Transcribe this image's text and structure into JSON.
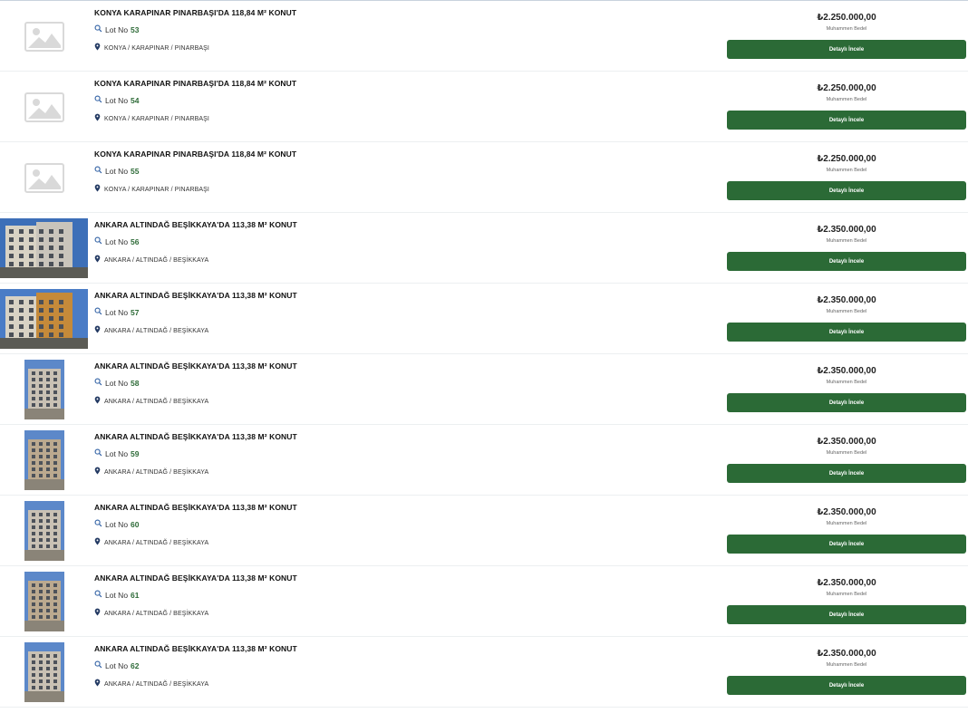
{
  "colors": {
    "accent": "#2b6a36",
    "lot_number": "#2e6b38",
    "divider": "#eceff1"
  },
  "listings": [
    {
      "title": "KONYA KARAPINAR PINARBAŞI'DA 118,84 M² KONUT",
      "lot_label": "Lot No",
      "lot_no": "53",
      "location": "KONYA / KARAPINAR / PINARBAŞI",
      "price": "₺2.250.000,00",
      "price_caption": "Muhammen Bedel",
      "button": "Detaylı İncele",
      "image": "placeholder"
    },
    {
      "title": "KONYA KARAPINAR PINARBAŞI'DA 118,84 M² KONUT",
      "lot_label": "Lot No",
      "lot_no": "54",
      "location": "KONYA / KARAPINAR / PINARBAŞI",
      "price": "₺2.250.000,00",
      "price_caption": "Muhammen Bedel",
      "button": "Detaylı İncele",
      "image": "placeholder"
    },
    {
      "title": "KONYA KARAPINAR PINARBAŞI'DA 118,84 M² KONUT",
      "lot_label": "Lot No",
      "lot_no": "55",
      "location": "KONYA / KARAPINAR / PINARBAŞI",
      "price": "₺2.250.000,00",
      "price_caption": "Muhammen Bedel",
      "button": "Detaylı İncele",
      "image": "placeholder"
    },
    {
      "title": "ANKARA ALTINDAĞ BEŞİKKAYA'DA 113,38 M² KONUT",
      "lot_label": "Lot No",
      "lot_no": "56",
      "location": "ANKARA / ALTINDAĞ / BEŞİKKAYA",
      "price": "₺2.350.000,00",
      "price_caption": "Muhammen Bedel",
      "button": "Detaylı İncele",
      "image": "photo-wide"
    },
    {
      "title": "ANKARA ALTINDAĞ BEŞİKKAYA'DA 113,38 M² KONUT",
      "lot_label": "Lot No",
      "lot_no": "57",
      "location": "ANKARA / ALTINDAĞ / BEŞİKKAYA",
      "price": "₺2.350.000,00",
      "price_caption": "Muhammen Bedel",
      "button": "Detaylı İncele",
      "image": "photo-wide"
    },
    {
      "title": "ANKARA ALTINDAĞ BEŞİKKAYA'DA 113,38 M² KONUT",
      "lot_label": "Lot No",
      "lot_no": "58",
      "location": "ANKARA / ALTINDAĞ / BEŞİKKAYA",
      "price": "₺2.350.000,00",
      "price_caption": "Muhammen Bedel",
      "button": "Detaylı İncele",
      "image": "photo-tall"
    },
    {
      "title": "ANKARA ALTINDAĞ BEŞİKKAYA'DA 113,38 M² KONUT",
      "lot_label": "Lot No",
      "lot_no": "59",
      "location": "ANKARA / ALTINDAĞ / BEŞİKKAYA",
      "price": "₺2.350.000,00",
      "price_caption": "Muhammen Bedel",
      "button": "Detaylı İncele",
      "image": "photo-tall"
    },
    {
      "title": "ANKARA ALTINDAĞ BEŞİKKAYA'DA 113,38 M² KONUT",
      "lot_label": "Lot No",
      "lot_no": "60",
      "location": "ANKARA / ALTINDAĞ / BEŞİKKAYA",
      "price": "₺2.350.000,00",
      "price_caption": "Muhammen Bedel",
      "button": "Detaylı İncele",
      "image": "photo-tall"
    },
    {
      "title": "ANKARA ALTINDAĞ BEŞİKKAYA'DA 113,38 M² KONUT",
      "lot_label": "Lot No",
      "lot_no": "61",
      "location": "ANKARA / ALTINDAĞ / BEŞİKKAYA",
      "price": "₺2.350.000,00",
      "price_caption": "Muhammen Bedel",
      "button": "Detaylı İncele",
      "image": "photo-tall"
    },
    {
      "title": "ANKARA ALTINDAĞ BEŞİKKAYA'DA 113,38 M² KONUT",
      "lot_label": "Lot No",
      "lot_no": "62",
      "location": "ANKARA / ALTINDAĞ / BEŞİKKAYA",
      "price": "₺2.350.000,00",
      "price_caption": "Muhammen Bedel",
      "button": "Detaylı İncele",
      "image": "photo-tall"
    }
  ]
}
